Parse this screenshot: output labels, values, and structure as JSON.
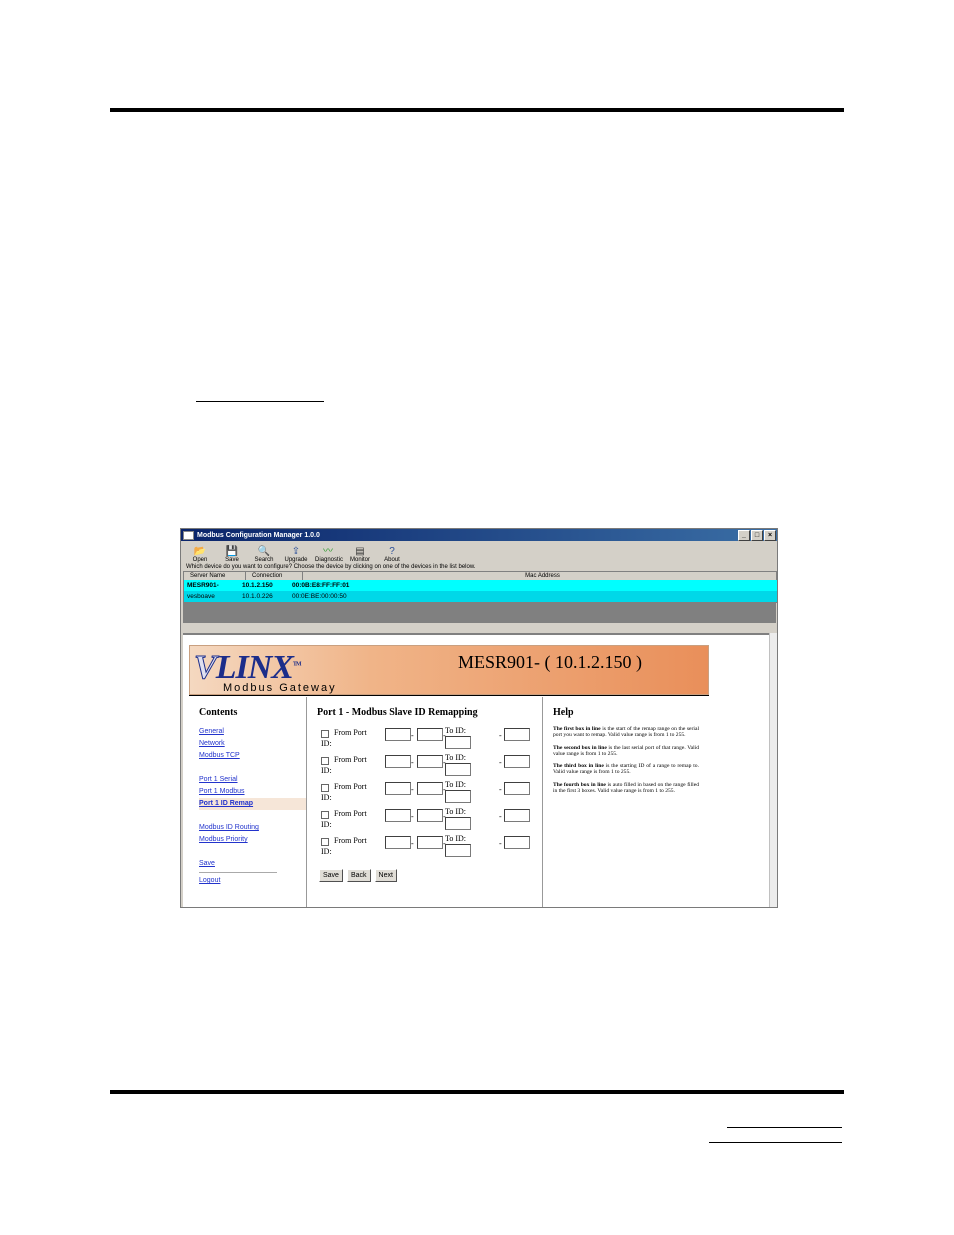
{
  "app": {
    "title": "Modbus Configuration Manager 1.0.0",
    "window_buttons": [
      "_",
      "□",
      "×"
    ],
    "toolbar": [
      {
        "label": "Open",
        "icon": "open-icon",
        "glyph": "📂"
      },
      {
        "label": "Save",
        "icon": "save-icon",
        "glyph": "💾"
      },
      {
        "label": "Search",
        "icon": "search-icon",
        "glyph": "🔍"
      },
      {
        "label": "Upgrade",
        "icon": "upgrade-icon",
        "glyph": "⇪"
      },
      {
        "label": "Diagnostic",
        "icon": "diagnostic-icon",
        "glyph": "〰"
      },
      {
        "label": "Monitor",
        "icon": "monitor-icon",
        "glyph": "▤"
      },
      {
        "label": "About",
        "icon": "about-icon",
        "glyph": "?"
      }
    ],
    "prompt": "Which device do you want to configure? Choose the device by clicking on one of the devices in the list below.",
    "devices": {
      "headers": [
        "Server Name",
        "Connection",
        "Mac Address"
      ],
      "rows": [
        [
          "MESR901-",
          "10.1.2.150",
          "00:0B:E8:FF:FF:01"
        ],
        [
          "vesboave",
          "10.1.0.226",
          "00:0E:BE:00:00:50"
        ]
      ]
    }
  },
  "page": {
    "logo_text": "LINX",
    "logo_v": "V",
    "logo_tm": "TM",
    "logo_sub": "Modbus Gateway",
    "device_title": "MESR901- ( 10.1.2.150 )",
    "contents_heading": "Contents",
    "nav": {
      "group1": [
        "General",
        "Network",
        "Modbus TCP"
      ],
      "group2": [
        "Port 1 Serial",
        "Port 1 Modbus",
        "Port 1 ID Remap"
      ],
      "group3": [
        "Modbus ID Routing",
        "Modbus Priority"
      ],
      "save": "Save",
      "logout": "Logout"
    },
    "remap_heading": "Port 1 - Modbus Slave ID Remapping",
    "row_label_a": "From Port",
    "row_label_b": "ID:",
    "to_id_label": "To ID:",
    "dash": "-",
    "buttons": {
      "save": "Save",
      "back": "Back",
      "next": "Next"
    },
    "help_heading": "Help",
    "help": [
      {
        "bold": "The first box in line",
        "text": " is the start of the remap range on the serial port you want to remap. Valid value range is from 1 to 255."
      },
      {
        "bold": "The second box in line",
        "text": " is the last serial port of that range. Valid value range is from 1 to 255."
      },
      {
        "bold": "The third box in line",
        "text": " is the starting ID of a range to remap to. Valid value range is from 1 to 255."
      },
      {
        "bold": "The fourth box in line",
        "text": " is auto filled in based on the range filled in the first 3 boxes. Valid value range is from 1 to 255."
      }
    ]
  }
}
